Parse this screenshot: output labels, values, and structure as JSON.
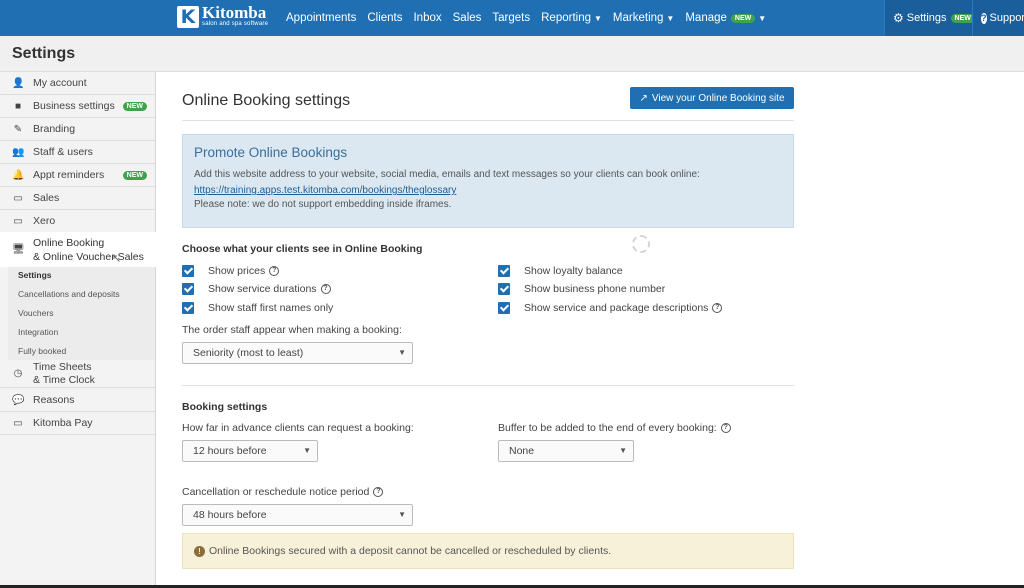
{
  "brand": {
    "name": "Kitomba",
    "tagline": "salon and spa software",
    "logo_letter": "K"
  },
  "nav": {
    "links": [
      {
        "label": "Appointments",
        "caret": false
      },
      {
        "label": "Clients",
        "caret": false
      },
      {
        "label": "Inbox",
        "caret": false
      },
      {
        "label": "Sales",
        "caret": false
      },
      {
        "label": "Targets",
        "caret": false
      },
      {
        "label": "Reporting",
        "caret": true
      },
      {
        "label": "Marketing",
        "caret": true
      },
      {
        "label": "Manage",
        "caret": true,
        "badge": "NEW"
      }
    ],
    "settings_label": "Settings",
    "settings_badge": "NEW",
    "support_label": "Support"
  },
  "page": {
    "title": "Settings"
  },
  "sidebar": {
    "items": [
      {
        "label": "My account",
        "icon": "user-icon"
      },
      {
        "label": "Business settings",
        "icon": "briefcase-icon",
        "badge": "NEW"
      },
      {
        "label": "Branding",
        "icon": "brush-icon"
      },
      {
        "label": "Staff & users",
        "icon": "users-icon"
      },
      {
        "label": "Appt reminders",
        "icon": "bell-icon",
        "badge": "NEW"
      },
      {
        "label": "Sales",
        "icon": "card-icon"
      },
      {
        "label": "Xero",
        "icon": "card-icon"
      }
    ],
    "active": {
      "line1": "Online Booking",
      "line2": "& Online Voucher Sales",
      "icon": "monitor-icon"
    },
    "subitems": [
      "Settings",
      "Cancellations and deposits",
      "Vouchers",
      "Integration",
      "Fully booked"
    ],
    "after": [
      {
        "line1": "Time Sheets",
        "line2": "& Time Clock",
        "icon": "clock-icon"
      },
      {
        "label": "Reasons",
        "icon": "speech-icon"
      },
      {
        "label": "Kitomba Pay",
        "icon": "card-icon"
      }
    ]
  },
  "main": {
    "title": "Online Booking settings",
    "view_button": "View your Online Booking site",
    "promo": {
      "title": "Promote Online Bookings",
      "text": "Add this website address to your website, social media, emails and text messages so your clients can book online:",
      "link": "https://training.apps.test.kitomba.com/bookings/theglossary",
      "note": "Please note: we do not support embedding inside iframes."
    },
    "visibility": {
      "title": "Choose what your clients see in Online Booking",
      "left": [
        {
          "label": "Show prices",
          "help": true
        },
        {
          "label": "Show service durations",
          "help": true
        },
        {
          "label": "Show staff first names only",
          "help": false
        }
      ],
      "right": [
        {
          "label": "Show loyalty balance",
          "help": false
        },
        {
          "label": "Show business phone number",
          "help": false
        },
        {
          "label": "Show service and package descriptions",
          "help": true
        }
      ],
      "order_label": "The order staff appear when making a booking:",
      "order_value": "Seniority (most to least)"
    },
    "booking": {
      "title": "Booking settings",
      "advance_label": "How far in advance clients can request a booking:",
      "advance_value": "12 hours before",
      "buffer_label": "Buffer to be added to the end of every booking:",
      "buffer_value": "None",
      "cancel_label": "Cancellation or reschedule notice period",
      "cancel_value": "48 hours before"
    },
    "warning": "Online Bookings secured with a deposit cannot be cancelled or rescheduled by clients."
  }
}
